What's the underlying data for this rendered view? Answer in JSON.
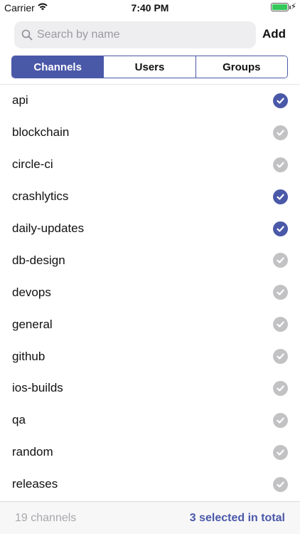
{
  "status_bar": {
    "carrier": "Carrier",
    "time": "7:40 PM",
    "icons": [
      "wifi-icon",
      "battery-icon",
      "charging-bolt-icon"
    ]
  },
  "search": {
    "placeholder": "Search by name",
    "value": "",
    "icon": "search-icon"
  },
  "add_label": "Add",
  "tabs": [
    {
      "label": "Channels",
      "active": true
    },
    {
      "label": "Users",
      "active": false
    },
    {
      "label": "Groups",
      "active": false
    }
  ],
  "channels": [
    {
      "name": "api",
      "selected": true
    },
    {
      "name": "blockchain",
      "selected": false
    },
    {
      "name": "circle-ci",
      "selected": false
    },
    {
      "name": "crashlytics",
      "selected": true
    },
    {
      "name": "daily-updates",
      "selected": true
    },
    {
      "name": "db-design",
      "selected": false
    },
    {
      "name": "devops",
      "selected": false
    },
    {
      "name": "general",
      "selected": false
    },
    {
      "name": "github",
      "selected": false
    },
    {
      "name": "ios-builds",
      "selected": false
    },
    {
      "name": "qa",
      "selected": false
    },
    {
      "name": "random",
      "selected": false
    },
    {
      "name": "releases",
      "selected": false
    }
  ],
  "footer": {
    "count_label": "19 channels",
    "selected_label": "3 selected in total"
  },
  "colors": {
    "accent": "#4a58a8",
    "check_off": "#c2c2c4",
    "battery": "#34c759"
  }
}
